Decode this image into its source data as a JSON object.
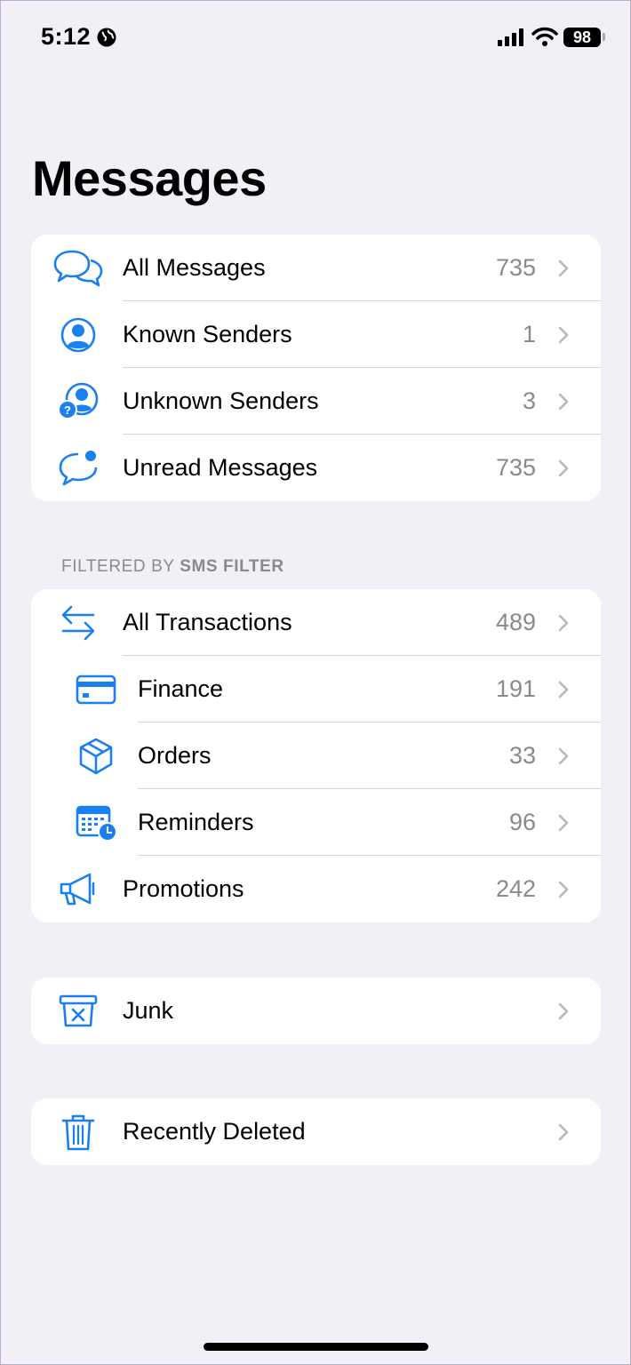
{
  "status_bar": {
    "time": "5:12",
    "battery": "98"
  },
  "page_title": "Messages",
  "group1": [
    {
      "icon": "speech-bubbles-icon",
      "label": "All Messages",
      "count": "735"
    },
    {
      "icon": "person-circle-icon",
      "label": "Known Senders",
      "count": "1"
    },
    {
      "icon": "person-question-icon",
      "label": "Unknown Senders",
      "count": "3"
    },
    {
      "icon": "bubble-unread-icon",
      "label": "Unread Messages",
      "count": "735"
    }
  ],
  "section_header": {
    "prefix": "FILTERED BY ",
    "filter_name": "SMS FILTER"
  },
  "group2": [
    {
      "icon": "arrows-left-right-icon",
      "label": "All Transactions",
      "count": "489"
    },
    {
      "icon": "credit-card-icon",
      "label": "Finance",
      "count": "191"
    },
    {
      "icon": "box-icon",
      "label": "Orders",
      "count": "33"
    },
    {
      "icon": "calendar-clock-icon",
      "label": "Reminders",
      "count": "96"
    },
    {
      "icon": "megaphone-icon",
      "label": "Promotions",
      "count": "242"
    }
  ],
  "junk": {
    "icon": "trash-x-icon",
    "label": "Junk"
  },
  "recently_deleted": {
    "icon": "trash-icon",
    "label": "Recently Deleted"
  },
  "colors": {
    "accent": "#1a7ff0",
    "background": "#f1f0f6",
    "secondary_text": "#8a8a8e"
  }
}
